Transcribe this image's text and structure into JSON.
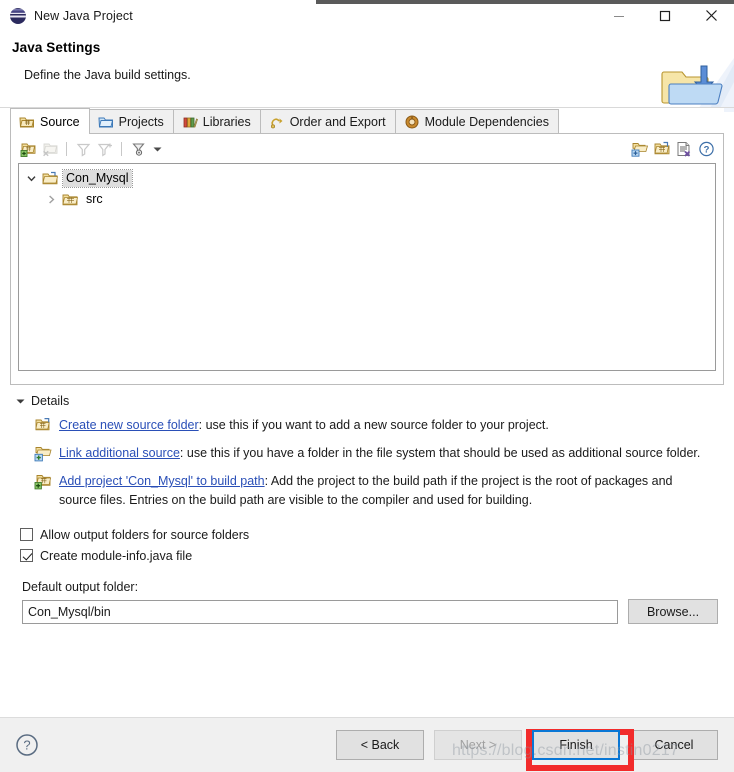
{
  "window": {
    "title": "New Java Project",
    "app_icon": "eclipse-globe-icon",
    "minimize_label": "—",
    "maximize_label": "□",
    "close_label": "✕"
  },
  "header": {
    "title": "Java Settings",
    "subtitle": "Define the Java build settings.",
    "banner_icon": "java-folder-banner-icon"
  },
  "tabs": [
    {
      "label": "Source",
      "icon": "source-folder-icon",
      "active": true
    },
    {
      "label": "Projects",
      "icon": "projects-folder-icon",
      "active": false
    },
    {
      "label": "Libraries",
      "icon": "libraries-books-icon",
      "active": false
    },
    {
      "label": "Order and Export",
      "icon": "order-export-icon",
      "active": false
    },
    {
      "label": "Module Dependencies",
      "icon": "module-dependencies-icon",
      "active": false
    }
  ],
  "tree_toolbar": {
    "left_icons": [
      {
        "name": "add-source-folder-icon",
        "enabled": true
      },
      {
        "name": "remove-source-folder-icon",
        "enabled": false
      },
      {
        "name": "filter-icon",
        "enabled": false
      },
      {
        "name": "add-filter-icon",
        "enabled": false
      },
      {
        "name": "configure-filters-icon",
        "enabled": true
      }
    ],
    "dropdown_caret": "chevron-down-icon",
    "right_icons": [
      {
        "name": "create-new-source-folder-icon",
        "enabled": true
      },
      {
        "name": "link-additional-source-icon",
        "enabled": true
      },
      {
        "name": "remove-entry-icon",
        "enabled": true
      },
      {
        "name": "help-icon",
        "enabled": true
      }
    ]
  },
  "tree": {
    "root": {
      "label": "Con_Mysql",
      "icon": "project-folder-icon",
      "expanded": true,
      "selected": true,
      "twisty": "chevron-down-icon"
    },
    "child": {
      "label": "src",
      "icon": "source-folder-icon",
      "expanded": false,
      "selected": false,
      "twisty": "chevron-right-icon"
    }
  },
  "details": {
    "header": "Details",
    "expanded": true,
    "twisty": "triangle-down-icon",
    "items": [
      {
        "icon": "create-new-source-folder-icon",
        "link": "Create new source folder",
        "text": ": use this if you want to add a new source folder to your project."
      },
      {
        "icon": "link-additional-source-icon",
        "link": "Link additional source",
        "text": ": use this if you have a folder in the file system that should be used as additional source folder."
      },
      {
        "icon": "add-project-to-build-path-icon",
        "link": "Add project 'Con_Mysql' to build path",
        "text": ": Add the project to the build path if the project is the root of packages and source files. Entries on the build path are visible to the compiler and used for building."
      }
    ]
  },
  "options": [
    {
      "label": "Allow output folders for source folders",
      "checked": false
    },
    {
      "label": "Create module-info.java file",
      "checked": true
    }
  ],
  "output_folder": {
    "label": "Default output folder:",
    "value": "Con_Mysql/bin",
    "placeholder": "",
    "browse_label": "Browse..."
  },
  "footer": {
    "help_icon": "help-circle-icon",
    "buttons": [
      {
        "label": "< Back",
        "state": "enabled"
      },
      {
        "label": "Next >",
        "state": "disabled"
      },
      {
        "label": "Finish",
        "state": "focused"
      },
      {
        "label": "Cancel",
        "state": "enabled"
      }
    ],
    "annotation_color": "#f22b2b",
    "focus_color": "#0a77d5",
    "watermark": "https://blog.csdn.net/instin0217"
  }
}
